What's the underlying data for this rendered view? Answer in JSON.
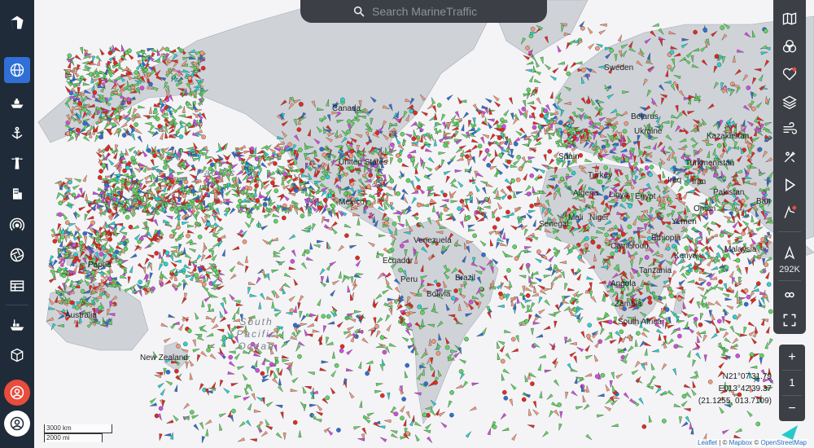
{
  "sidebar": {
    "items": [
      {
        "name": "logo-icon"
      },
      {
        "name": "globe-icon",
        "active": true
      },
      {
        "name": "ship-icon"
      },
      {
        "name": "anchor-icon"
      },
      {
        "name": "lighthouse-icon"
      },
      {
        "name": "building-icon"
      },
      {
        "name": "signal-icon"
      },
      {
        "name": "aperture-icon"
      },
      {
        "name": "table-icon"
      },
      {
        "name": "cargo-ship-icon"
      },
      {
        "name": "package-icon"
      },
      {
        "name": "user-alert-icon"
      },
      {
        "name": "user-account-icon"
      }
    ]
  },
  "search": {
    "placeholder": "Search MarineTraffic"
  },
  "right_panel": {
    "buttons": [
      "map-icon",
      "filter-icon",
      "favorites-icon",
      "layers-icon",
      "wind-icon",
      "tools-icon",
      "play-icon",
      "routes-icon"
    ],
    "vessel_count": "292K"
  },
  "zoom": {
    "plus": "+",
    "level": "1",
    "minus": "−"
  },
  "coords": {
    "lat": "N21°07'31.79",
    "lon": "E013°42'39.37",
    "decimal": "(21.1255, 013.7109)"
  },
  "scale": {
    "km": "3000 km",
    "mi": "2000 mi"
  },
  "attribution": {
    "leaflet": "Leaflet",
    "sep1": " | © ",
    "mapbox": "Mapbox",
    "sep2": " © ",
    "osm": "OpenStreetMap"
  },
  "labels": {
    "countries": [
      {
        "text": "Canada"
      },
      {
        "text": "United States"
      },
      {
        "text": "Mexico"
      },
      {
        "text": "Venezuela"
      },
      {
        "text": "Ecuador"
      },
      {
        "text": "Peru"
      },
      {
        "text": "Brazil"
      },
      {
        "text": "Bolivia"
      },
      {
        "text": "Algeria"
      },
      {
        "text": "Libya"
      },
      {
        "text": "Egypt"
      },
      {
        "text": "Mali"
      },
      {
        "text": "Niger"
      },
      {
        "text": "Senegal"
      },
      {
        "text": "Cameroon"
      },
      {
        "text": "Ethiopia"
      },
      {
        "text": "Kenya"
      },
      {
        "text": "Tanzania"
      },
      {
        "text": "Angola"
      },
      {
        "text": "Zambia"
      },
      {
        "text": "South Africa"
      },
      {
        "text": "Yemen"
      },
      {
        "text": "Oman"
      },
      {
        "text": "Iraq"
      },
      {
        "text": "Iran"
      },
      {
        "text": "Turkmenistan"
      },
      {
        "text": "Kazakhstan"
      },
      {
        "text": "Pakistan"
      },
      {
        "text": "Bangladesh"
      },
      {
        "text": "Belarus"
      },
      {
        "text": "Ukraine"
      },
      {
        "text": "Spain"
      },
      {
        "text": "Sweden"
      },
      {
        "text": "Turkey"
      },
      {
        "text": "Malaysia"
      },
      {
        "text": "Papua"
      },
      {
        "text": "Australia"
      },
      {
        "text": "New Zealand"
      }
    ],
    "oceans": [
      {
        "text": "Pacific"
      },
      {
        "text": "South Pacific Ocean"
      }
    ]
  },
  "colors": {
    "sidebar_bg": "#1f2b38",
    "accent": "#2f6fd6",
    "panel_bg": "#3c3f45",
    "land": "#cfd3d8",
    "water": "#f4f4f6",
    "cargo": "#5fd65f",
    "tanker": "#e8291f",
    "passenger": "#2f6fd6",
    "tug": "#27d3d3",
    "fishing": "#f29a7a",
    "pleasure": "#d24de0",
    "alert": "#e74c3c"
  }
}
